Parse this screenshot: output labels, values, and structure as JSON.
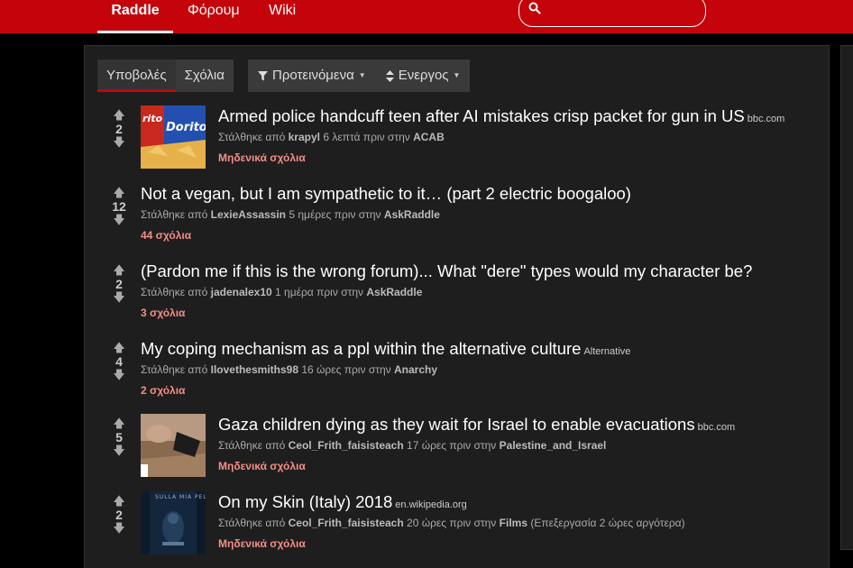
{
  "nav": {
    "brand": "Raddle",
    "forums": "Φόρουμ",
    "wiki": "Wiki",
    "search_placeholder": ""
  },
  "tabs": [
    {
      "label": "Υποβολές"
    },
    {
      "label": "Σχόλια"
    }
  ],
  "filters": {
    "sort": "Προτεινόμενα",
    "time": "Ενεργος"
  },
  "labels": {
    "posted_by": "Στάλθηκε από",
    "in": "στην"
  },
  "submissions": [
    {
      "score": "2",
      "title": "Armed police handcuff teen after AI mistakes crisp packet for gun in US",
      "domain": "bbc.com",
      "author": "krapyl",
      "time": "6 λεπτά πριν",
      "forum": "ACAB",
      "edited": "",
      "comments": "Μηδενικά σχόλια",
      "thumb": "doritos"
    },
    {
      "score": "12",
      "title": "Not a vegan, but I am sympathetic to it… (part 2 electric boogaloo)",
      "domain": "",
      "author": "LexieAssassin",
      "time": "5 ημέρες πριν",
      "forum": "AskRaddle",
      "edited": "",
      "comments": "44 σχόλια",
      "thumb": ""
    },
    {
      "score": "2",
      "title": "(Pardon me if this is the wrong forum)... What \"dere\" types would my character be?",
      "domain": "",
      "author": "jadenalex10",
      "time": "1 ημέρα πριν",
      "forum": "AskRaddle",
      "edited": "",
      "comments": "3 σχόλια",
      "thumb": ""
    },
    {
      "score": "4",
      "title": "My coping mechanism as a ppl within the alternative culture",
      "domain": "Alternative",
      "author": "Ilovethesmiths98",
      "time": "16 ώρες πριν",
      "forum": "Anarchy",
      "edited": "",
      "comments": "2 σχόλια",
      "thumb": ""
    },
    {
      "score": "5",
      "title": "Gaza children dying as they wait for Israel to enable evacuations",
      "domain": "bbc.com",
      "author": "Ceol_Frith_faisisteach",
      "time": "17 ώρες πριν",
      "forum": "Palestine_and_Israel",
      "edited": "",
      "comments": "Μηδενικά σχόλια",
      "thumb": "gaza"
    },
    {
      "score": "2",
      "title": "On my Skin (Italy) 2018",
      "domain": "en.wikipedia.org",
      "author": "Ceol_Frith_faisisteach",
      "time": "20 ώρες πριν",
      "forum": "Films",
      "edited": "(Επεξεργασία 2 ώρες αργότερα)",
      "comments": "Μηδενικά σχόλια",
      "thumb": "poster"
    }
  ]
}
